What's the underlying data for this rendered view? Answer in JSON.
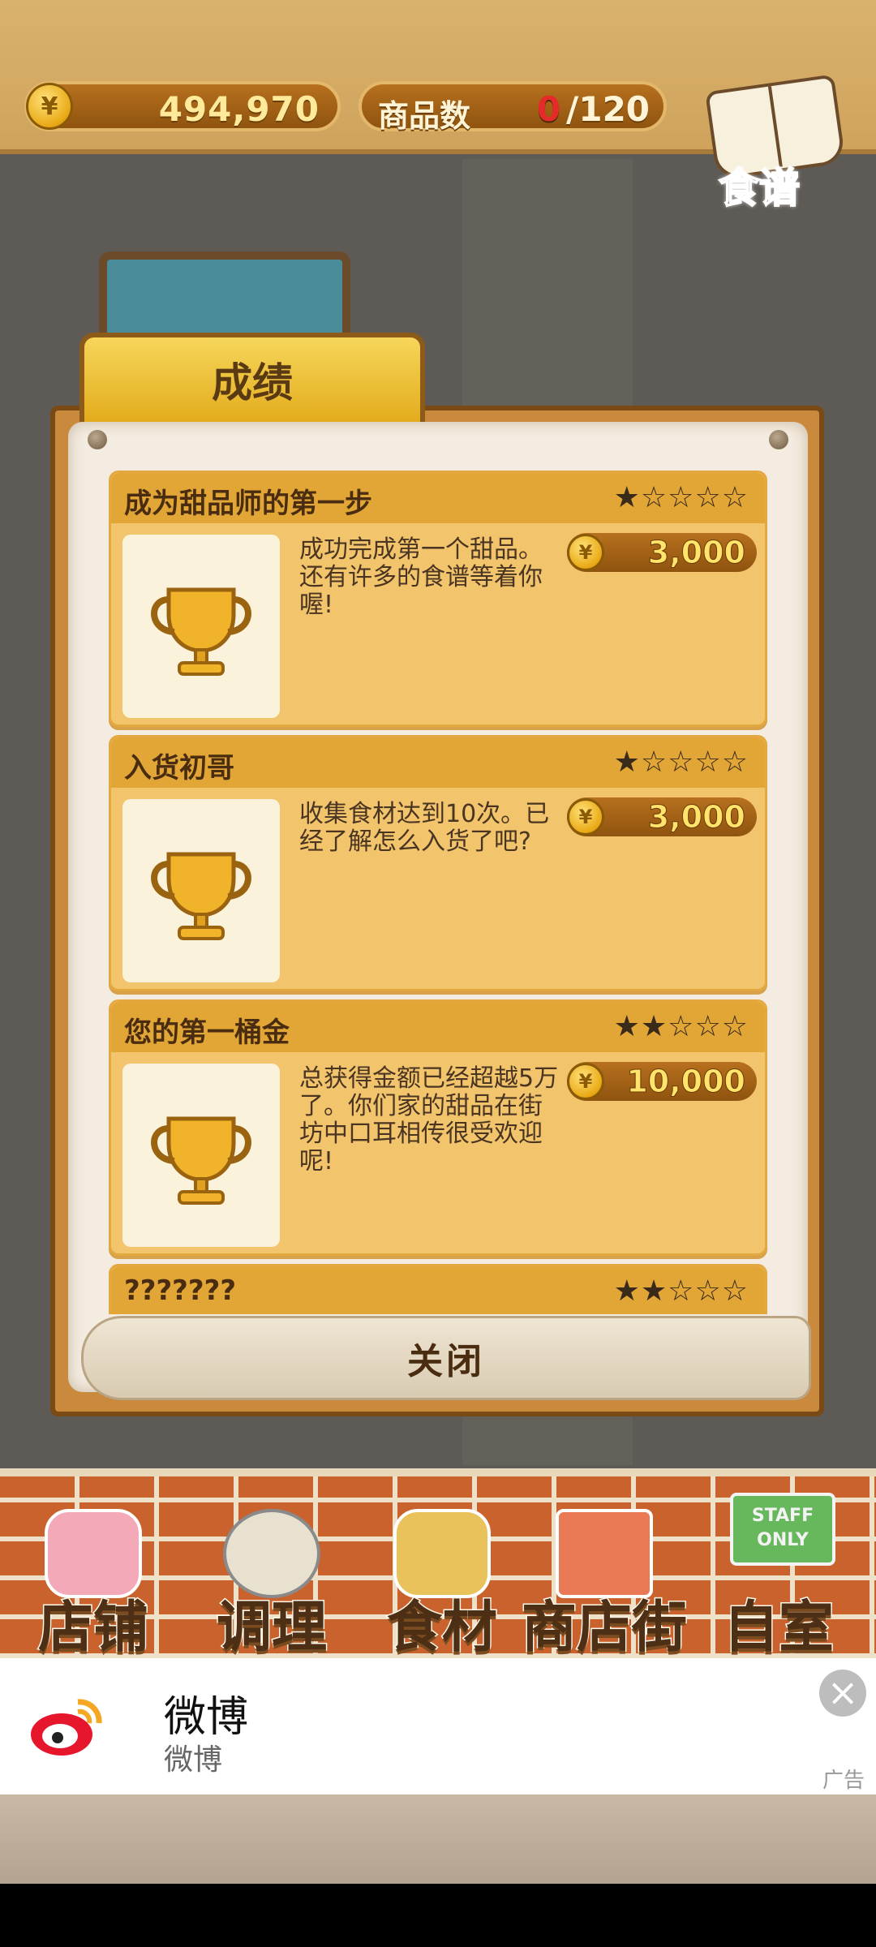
{
  "header": {
    "money": "494,970",
    "product_count_label": "商品数",
    "product_count_current": "0",
    "product_count_max": "/120",
    "recipe_label": "食谱"
  },
  "panel": {
    "title": "成绩",
    "close_label": "关闭",
    "achievements": [
      {
        "title": "成为甜品师的第一步",
        "stars": "★☆☆☆☆",
        "description": "成功完成第一个甜品。还有许多的食谱等着你喔!",
        "reward": "3,000"
      },
      {
        "title": "入货初哥",
        "stars": "★☆☆☆☆",
        "description": "收集食材达到10次。已经了解怎么入货了吧?",
        "reward": "3,000"
      },
      {
        "title": "您的第一桶金",
        "stars": "★★☆☆☆",
        "description": "总获得金额已经超越5万了。你们家的甜品在街坊中口耳相传很受欢迎呢!",
        "reward": "10,000"
      },
      {
        "title": "???????",
        "stars": "★★☆☆☆"
      }
    ]
  },
  "nav": {
    "items": [
      {
        "label": "店铺"
      },
      {
        "label": "调理"
      },
      {
        "label": "食材"
      },
      {
        "label": "商店街"
      },
      {
        "label": "自室"
      }
    ],
    "staff_sign": "STAFF ONLY"
  },
  "ad": {
    "title": "微博",
    "subtitle": "微博",
    "tag": "广告",
    "close_icon": "×"
  },
  "colors": {
    "coin_symbol": "¥",
    "accent": "#e2a637",
    "frame": "#7a4a14"
  }
}
